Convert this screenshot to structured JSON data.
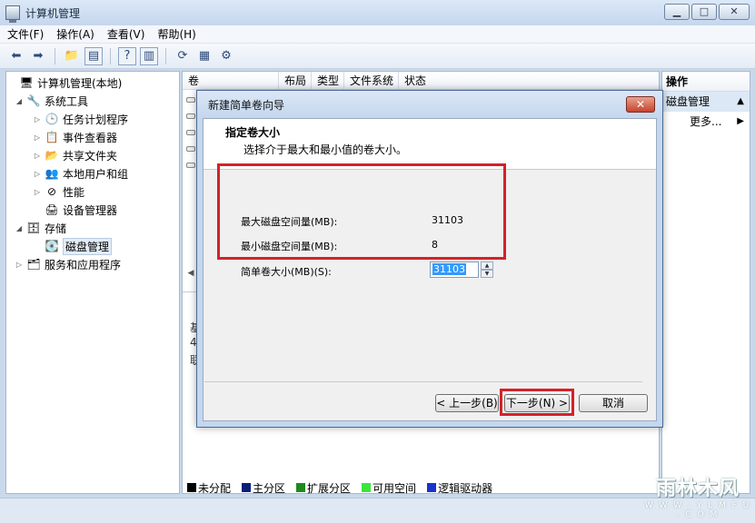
{
  "window": {
    "title": "计算机管理"
  },
  "menu": [
    "文件(F)",
    "操作(A)",
    "查看(V)",
    "帮助(H)"
  ],
  "tree": {
    "root": "计算机管理(本地)",
    "system_tools": "系统工具",
    "task_scheduler": "任务计划程序",
    "event_viewer": "事件查看器",
    "shared_folders": "共享文件夹",
    "local_users": "本地用户和组",
    "performance": "性能",
    "device_manager": "设备管理器",
    "storage": "存储",
    "disk_management": "磁盘管理",
    "services": "服务和应用程序"
  },
  "columns": [
    "卷",
    "布局",
    "类型",
    "文件系统",
    "状态"
  ],
  "lower_fragments": [
    "基",
    "4",
    "联"
  ],
  "legend": [
    "未分配",
    "主分区",
    "扩展分区",
    "可用空间",
    "逻辑驱动器"
  ],
  "legend_colors": [
    "#000000",
    "#0a1f7a",
    "#1e8a1e",
    "#39e639",
    "#1a33cc"
  ],
  "actions": {
    "header": "操作",
    "subheader": "磁盘管理",
    "more": "更多..."
  },
  "dialog": {
    "title": "新建简单卷向导",
    "heading": "指定卷大小",
    "subheading": "选择介于最大和最小值的卷大小。",
    "max_label": "最大磁盘空间量(MB):",
    "max_value": "31103",
    "min_label": "最小磁盘空间量(MB):",
    "min_value": "8",
    "size_label": "简单卷大小(MB)(S):",
    "size_value": "31103",
    "back_button": "< 上一步(B)",
    "next_button": "下一步(N) >",
    "cancel_button": "取消"
  },
  "watermark": {
    "logo": "雨林木风",
    "url": "W W W . Y L M F U . C O M"
  }
}
